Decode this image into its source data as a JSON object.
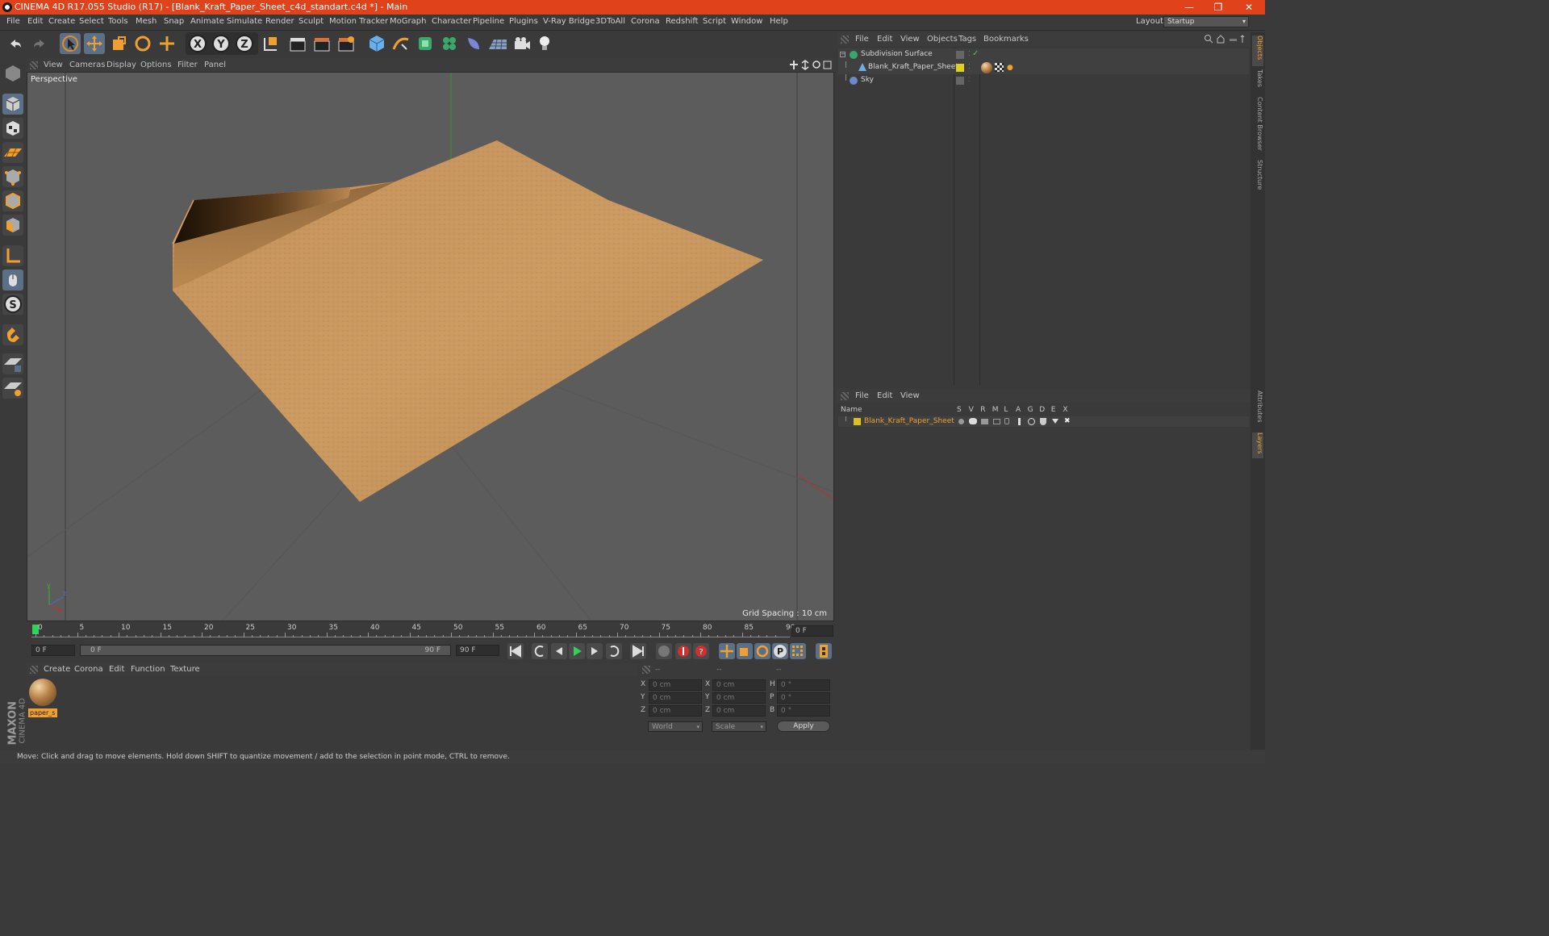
{
  "window": {
    "title": "CINEMA 4D R17.055 Studio (R17) - [Blank_Kraft_Paper_Sheet_c4d_standart.c4d *] - Main",
    "controls": [
      "—",
      "❐",
      "✕"
    ]
  },
  "menu": [
    "File",
    "Edit",
    "Create",
    "Select",
    "Tools",
    "Mesh",
    "Snap",
    "Animate",
    "Simulate",
    "Render",
    "Sculpt",
    "Motion Tracker",
    "MoGraph",
    "Character",
    "Pipeline",
    "Plugins",
    "V-Ray Bridge",
    "3DToAll",
    "Corona",
    "Redshift",
    "Script",
    "Window",
    "Help"
  ],
  "layout": {
    "label": "Layout:",
    "value": "Startup"
  },
  "viewport": {
    "menu": [
      "View",
      "Cameras",
      "Display",
      "Options",
      "Filter",
      "Panel"
    ],
    "name": "Perspective",
    "grid_spacing": "Grid Spacing : 10 cm"
  },
  "timeline": {
    "ticks": [
      "0",
      "5",
      "10",
      "15",
      "20",
      "25",
      "30",
      "35",
      "40",
      "45",
      "50",
      "55",
      "60",
      "65",
      "70",
      "75",
      "80",
      "85",
      "90"
    ],
    "current_frame": "0 F",
    "start_field": "0 F",
    "range_start": "0 F",
    "range_end": "90 F",
    "end_field": "90 F"
  },
  "material_manager": {
    "menu": [
      "Create",
      "Corona",
      "Edit",
      "Function",
      "Texture"
    ],
    "materials": [
      {
        "name": "paper_s"
      }
    ]
  },
  "coords": {
    "headers": [
      "--",
      "--",
      "--"
    ],
    "rows": [
      {
        "a": "X",
        "av": "0 cm",
        "b": "X",
        "bv": "0 cm",
        "c": "H",
        "cv": "0 °"
      },
      {
        "a": "Y",
        "av": "0 cm",
        "b": "Y",
        "bv": "0 cm",
        "c": "P",
        "cv": "0 °"
      },
      {
        "a": "Z",
        "av": "0 cm",
        "b": "Z",
        "bv": "0 cm",
        "c": "B",
        "cv": "0 °"
      }
    ],
    "space": "World",
    "mode": "Scale",
    "apply": "Apply"
  },
  "object_manager": {
    "menu": [
      "File",
      "Edit",
      "View",
      "Objects",
      "Tags",
      "Bookmarks"
    ],
    "objects": [
      {
        "name": "Subdivision Surface",
        "indent": 0
      },
      {
        "name": "Blank_Kraft_Paper_Sheet",
        "indent": 1
      },
      {
        "name": "Sky",
        "indent": 0
      }
    ]
  },
  "layer_manager": {
    "menu": [
      "File",
      "Edit",
      "View"
    ],
    "columns": {
      "name": "Name",
      "flags": [
        "S",
        "V",
        "R",
        "M",
        "L",
        "A",
        "G",
        "D",
        "E",
        "X"
      ]
    },
    "layers": [
      {
        "name": "Blank_Kraft_Paper_Sheet",
        "color": "#e0c020"
      }
    ]
  },
  "right_tabs": [
    "Objects",
    "Takes",
    "Content Browser",
    "Structure"
  ],
  "right_tabs_lower": [
    "Attributes",
    "Layers"
  ],
  "brand": {
    "top": "MAXON",
    "bottom": "CINEMA 4D"
  },
  "status": "Move: Click and drag to move elements. Hold down SHIFT to quantize movement / add to the selection in point mode, CTRL to remove.",
  "colors": {
    "title_bar": "#e0431b",
    "accent": "#f0a030",
    "selection": "#5b6f87",
    "paper": "#c99a5c"
  }
}
